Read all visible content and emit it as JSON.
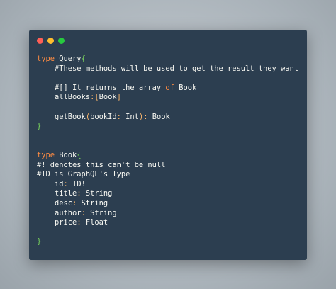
{
  "window": {
    "dots": [
      {
        "name": "close",
        "color": "#ff5f56"
      },
      {
        "name": "minimize",
        "color": "#ffbd2e"
      },
      {
        "name": "maximize",
        "color": "#27c93f"
      }
    ]
  },
  "colors": {
    "background": "#a9b2b9",
    "editor_bg": "#2c3e50",
    "keyword": "#ff8c42",
    "brace": "#7ddc5d",
    "punctuation": "#ffb86c",
    "text": "#f8f8f2"
  },
  "code": {
    "lines": [
      [
        {
          "t": "kw",
          "v": "type"
        },
        {
          "t": "pl",
          "v": " Query"
        },
        {
          "t": "br",
          "v": "{"
        }
      ],
      [
        {
          "t": "cm",
          "v": "    #These methods will be used to get the result they want"
        }
      ],
      [],
      [
        {
          "t": "cm",
          "v": "    #[] It returns the array "
        },
        {
          "t": "kw",
          "v": "of"
        },
        {
          "t": "cm",
          "v": " Book"
        }
      ],
      [
        {
          "t": "pl",
          "v": "    allBooks"
        },
        {
          "t": "pn",
          "v": ":"
        },
        {
          "t": "pn",
          "v": "["
        },
        {
          "t": "pl",
          "v": "Book"
        },
        {
          "t": "pn",
          "v": "]"
        }
      ],
      [],
      [
        {
          "t": "pl",
          "v": "    getBook"
        },
        {
          "t": "pn",
          "v": "("
        },
        {
          "t": "pl",
          "v": "bookId"
        },
        {
          "t": "pn",
          "v": ":"
        },
        {
          "t": "pl",
          "v": " Int"
        },
        {
          "t": "pn",
          "v": ")"
        },
        {
          "t": "pn",
          "v": ":"
        },
        {
          "t": "pl",
          "v": " Book"
        }
      ],
      [
        {
          "t": "br",
          "v": "}"
        }
      ],
      [],
      [],
      [
        {
          "t": "kw",
          "v": "type"
        },
        {
          "t": "pl",
          "v": " Book"
        },
        {
          "t": "br",
          "v": "{"
        }
      ],
      [
        {
          "t": "cm",
          "v": "#! denotes this can't be null"
        }
      ],
      [
        {
          "t": "cm",
          "v": "#ID is GraphQL's Type"
        }
      ],
      [
        {
          "t": "pl",
          "v": "    id"
        },
        {
          "t": "pn",
          "v": ":"
        },
        {
          "t": "pl",
          "v": " ID!"
        }
      ],
      [
        {
          "t": "pl",
          "v": "    title"
        },
        {
          "t": "pn",
          "v": ":"
        },
        {
          "t": "pl",
          "v": " String"
        }
      ],
      [
        {
          "t": "pl",
          "v": "    desc"
        },
        {
          "t": "pn",
          "v": ":"
        },
        {
          "t": "pl",
          "v": " String"
        }
      ],
      [
        {
          "t": "pl",
          "v": "    author"
        },
        {
          "t": "pn",
          "v": ":"
        },
        {
          "t": "pl",
          "v": " String"
        }
      ],
      [
        {
          "t": "pl",
          "v": "    price"
        },
        {
          "t": "pn",
          "v": ":"
        },
        {
          "t": "pl",
          "v": " Float"
        }
      ],
      [],
      [
        {
          "t": "br",
          "v": "}"
        }
      ]
    ]
  }
}
